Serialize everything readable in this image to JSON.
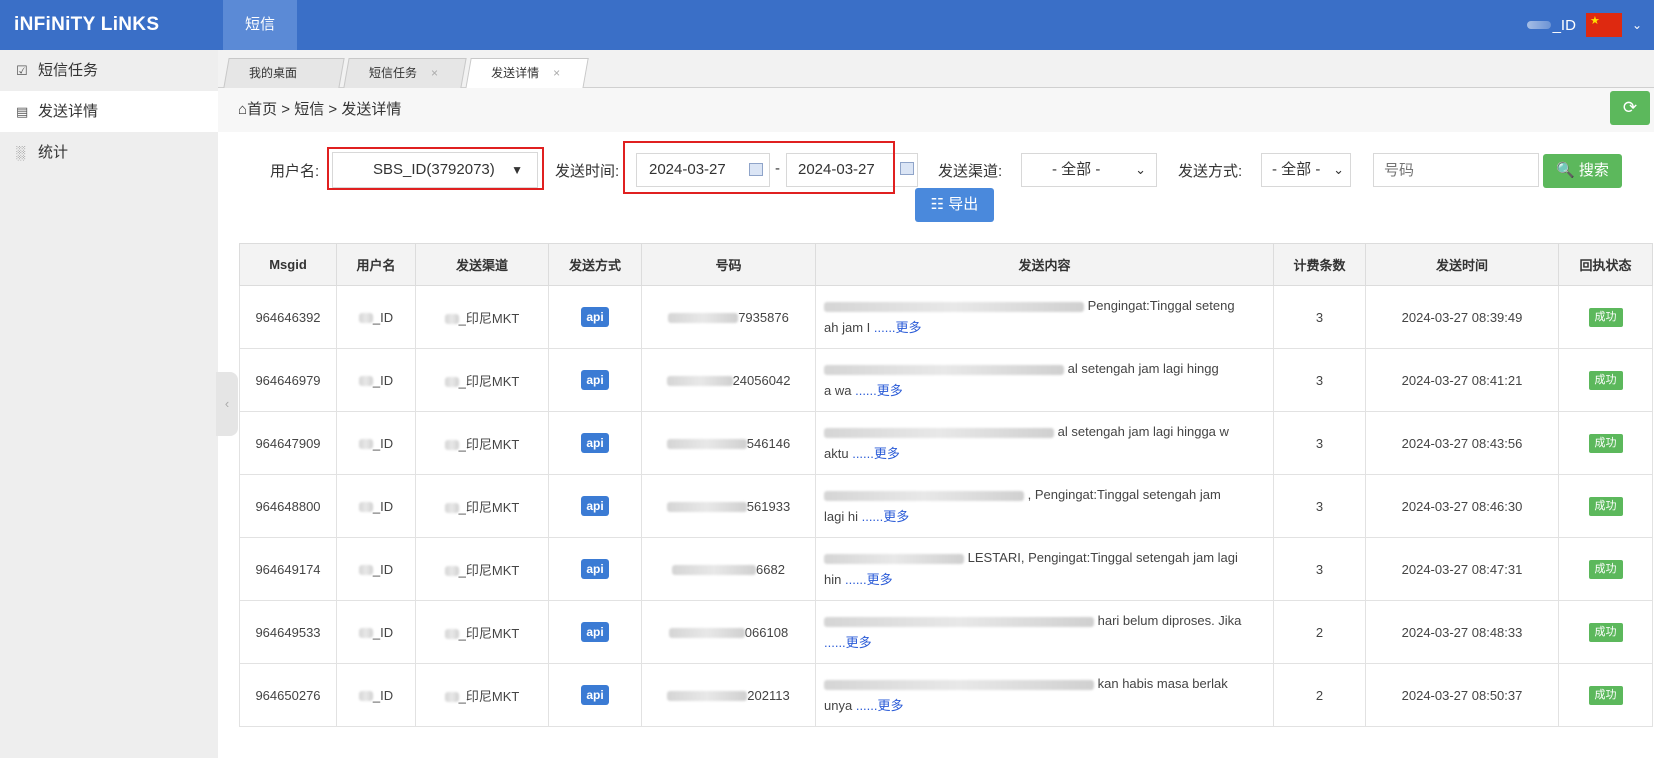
{
  "app": {
    "logo": "iNFiNiTY LiNKS",
    "top_tab": "短信",
    "user_suffix": "_ID"
  },
  "sidebar": {
    "items": [
      {
        "label": "短信任务",
        "icon": "task-icon"
      },
      {
        "label": "发送详情",
        "icon": "detail-icon"
      },
      {
        "label": "统计",
        "icon": "chart-icon"
      }
    ]
  },
  "tabs": [
    {
      "label": "我的桌面"
    },
    {
      "label": "短信任务"
    },
    {
      "label": "发送详情"
    }
  ],
  "breadcrumb": {
    "home": "首页",
    "sep": ">",
    "level1": "短信",
    "level2": "发送详情"
  },
  "filters": {
    "username_label": "用户名:",
    "username_value": "SBS_ID(3792073)",
    "time_label": "发送时间:",
    "date_from": "2024-03-27",
    "date_sep": "-",
    "date_to": "2024-03-27",
    "channel_label": "发送渠道:",
    "channel_value": "- 全部 -",
    "method_label": "发送方式:",
    "method_value": "- 全部 -",
    "number_placeholder": "号码",
    "search_button": "搜索",
    "export_button": "导出"
  },
  "table": {
    "headers": [
      "Msgid",
      "用户名",
      "发送渠道",
      "发送方式",
      "号码",
      "发送内容",
      "计费条数",
      "发送时间",
      "回执状态"
    ],
    "rows": [
      {
        "msgid": "964646392",
        "user": "_ID",
        "channel": "_印尼MKT",
        "method": "api",
        "number": "7935876",
        "content": "Pengingat:Tinggal seteng",
        "content2": "ah jam I",
        "more": "......更多",
        "count": "3",
        "time": "2024-03-27 08:39:49",
        "status": "成功"
      },
      {
        "msgid": "964646979",
        "user": "_ID",
        "channel": "_印尼MKT",
        "method": "api",
        "number": "24056042",
        "content": "al setengah jam lagi hingg",
        "content2": "a wa",
        "more": "......更多",
        "count": "3",
        "time": "2024-03-27 08:41:21",
        "status": "成功"
      },
      {
        "msgid": "964647909",
        "user": "_ID",
        "channel": "_印尼MKT",
        "method": "api",
        "number": "546146",
        "content": "al setengah jam lagi hingga w",
        "content2": "aktu",
        "more": "......更多",
        "count": "3",
        "time": "2024-03-27 08:43:56",
        "status": "成功"
      },
      {
        "msgid": "964648800",
        "user": "_ID",
        "channel": "_印尼MKT",
        "method": "api",
        "number": "561933",
        "content": ", Pengingat:Tinggal setengah jam",
        "content2": "lagi hi",
        "more": "......更多",
        "count": "3",
        "time": "2024-03-27 08:46:30",
        "status": "成功"
      },
      {
        "msgid": "964649174",
        "user": "_ID",
        "channel": "_印尼MKT",
        "method": "api",
        "number": "6682",
        "content": "LESTARI, Pengingat:Tinggal setengah jam lagi",
        "content2": "hin",
        "more": "......更多",
        "count": "3",
        "time": "2024-03-27 08:47:31",
        "status": "成功"
      },
      {
        "msgid": "964649533",
        "user": "_ID",
        "channel": "_印尼MKT",
        "method": "api",
        "number": "066108",
        "content": "hari belum diproses. Jika",
        "content2": "",
        "more": "......更多",
        "count": "2",
        "time": "2024-03-27 08:48:33",
        "status": "成功"
      },
      {
        "msgid": "964650276",
        "user": "_ID",
        "channel": "_印尼MKT",
        "method": "api",
        "number": "202113",
        "content": "kan habis masa berlak",
        "content2": "unya",
        "more": "......更多",
        "count": "2",
        "time": "2024-03-27 08:50:37",
        "status": "成功"
      }
    ]
  },
  "colors": {
    "topbar": "#3a6fc7",
    "success": "#5cb85c",
    "api": "#3b7bd4",
    "highlight": "#e02020"
  }
}
